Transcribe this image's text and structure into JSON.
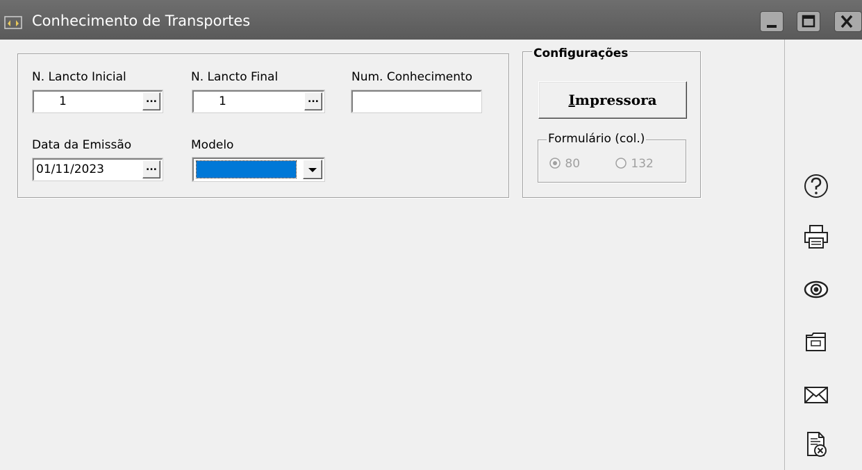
{
  "window": {
    "title": "Conhecimento de Transportes",
    "icon": "app-icon",
    "controls": [
      "minimize-icon",
      "maximize-icon",
      "close-icon"
    ]
  },
  "form": {
    "lancto_inicial": {
      "label": "N. Lancto Inicial",
      "value": "1",
      "button": "..."
    },
    "lancto_final": {
      "label": "N. Lancto Final",
      "value": "1",
      "button": "..."
    },
    "num_conhecimento": {
      "label": "Num. Conhecimento",
      "value": ""
    },
    "data_emissao": {
      "label": "Data da Emissão",
      "value": "01/11/2023",
      "button": "..."
    },
    "modelo": {
      "label": "Modelo",
      "value": ""
    }
  },
  "config": {
    "title": "Configurações",
    "printer_button": {
      "label_first": "I",
      "label_rest": "mpressora"
    },
    "formulario": {
      "title": "Formulário (col.)",
      "options": [
        {
          "label": "80",
          "selected": true
        },
        {
          "label": "132",
          "selected": false
        }
      ]
    }
  },
  "toolbar": [
    "help-icon",
    "print-icon",
    "preview-icon",
    "file-icon",
    "email-icon",
    "document-cancel-icon"
  ],
  "colors": {
    "titlebar": "#5f5f5f",
    "selection": "#0078d7",
    "background": "#f0f0f0"
  }
}
